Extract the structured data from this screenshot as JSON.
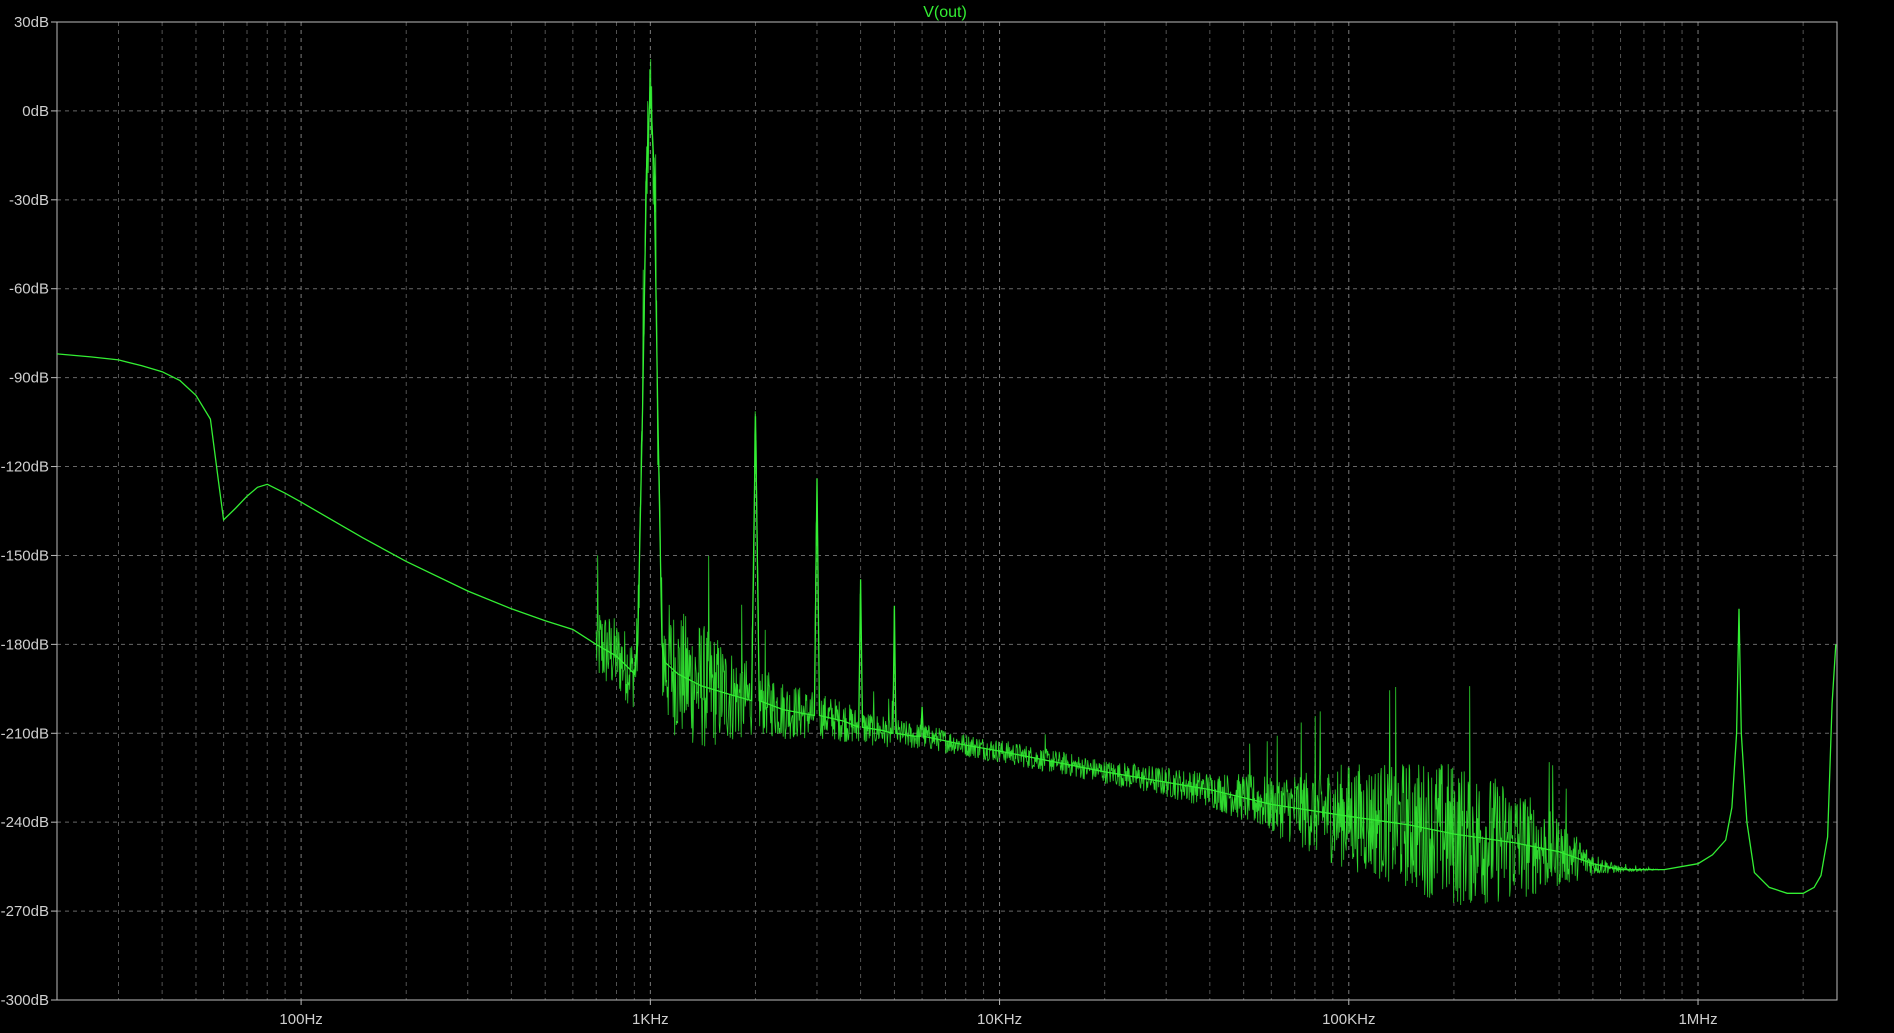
{
  "chart_data": {
    "type": "line",
    "title": "V(out)",
    "xlabel": "",
    "ylabel": "",
    "x_scale": "log",
    "x_unit": "Hz",
    "xlim": [
      20,
      2500000
    ],
    "ylim": [
      -300,
      30
    ],
    "grid": true,
    "x_ticks": [
      {
        "value": 100,
        "label": "100Hz"
      },
      {
        "value": 1000,
        "label": "1KHz"
      },
      {
        "value": 10000,
        "label": "10KHz"
      },
      {
        "value": 100000,
        "label": "100KHz"
      },
      {
        "value": 1000000,
        "label": "1MHz"
      }
    ],
    "y_ticks": [
      {
        "value": 30,
        "label": "30dB"
      },
      {
        "value": 0,
        "label": "0dB"
      },
      {
        "value": -30,
        "label": "-30dB"
      },
      {
        "value": -60,
        "label": "-60dB"
      },
      {
        "value": -90,
        "label": "-90dB"
      },
      {
        "value": -120,
        "label": "-120dB"
      },
      {
        "value": -150,
        "label": "-150dB"
      },
      {
        "value": -180,
        "label": "-180dB"
      },
      {
        "value": -210,
        "label": "-210dB"
      },
      {
        "value": -240,
        "label": "-240dB"
      },
      {
        "value": -270,
        "label": "-270dB"
      },
      {
        "value": -300,
        "label": "-300dB"
      }
    ],
    "series": [
      {
        "name": "V(out)",
        "color": "#33ee33",
        "points": [
          [
            20,
            -82
          ],
          [
            25,
            -83
          ],
          [
            30,
            -84
          ],
          [
            35,
            -86
          ],
          [
            40,
            -88
          ],
          [
            45,
            -91
          ],
          [
            50,
            -96
          ],
          [
            55,
            -104
          ],
          [
            58,
            -125
          ],
          [
            60,
            -138
          ],
          [
            65,
            -134
          ],
          [
            70,
            -130
          ],
          [
            75,
            -127
          ],
          [
            80,
            -126
          ],
          [
            90,
            -129
          ],
          [
            100,
            -132
          ],
          [
            150,
            -144
          ],
          [
            200,
            -152
          ],
          [
            300,
            -162
          ],
          [
            400,
            -168
          ],
          [
            500,
            -172
          ],
          [
            600,
            -175
          ],
          [
            700,
            -180
          ],
          [
            800,
            -184
          ],
          [
            850,
            -187
          ],
          [
            900,
            -190
          ],
          [
            920,
            -180
          ],
          [
            950,
            -100
          ],
          [
            975,
            -20
          ],
          [
            1000,
            8
          ],
          [
            1025,
            -20
          ],
          [
            1050,
            -100
          ],
          [
            1080,
            -180
          ],
          [
            1100,
            -186
          ],
          [
            1200,
            -190
          ],
          [
            1400,
            -194
          ],
          [
            1700,
            -197
          ],
          [
            1950,
            -199
          ],
          [
            2000,
            -103
          ],
          [
            2050,
            -199
          ],
          [
            2400,
            -202
          ],
          [
            2950,
            -204
          ],
          [
            3000,
            -124
          ],
          [
            3050,
            -204
          ],
          [
            3600,
            -206
          ],
          [
            3950,
            -208
          ],
          [
            4000,
            -158
          ],
          [
            4050,
            -208
          ],
          [
            4600,
            -209
          ],
          [
            4950,
            -210
          ],
          [
            5000,
            -167
          ],
          [
            5050,
            -210
          ],
          [
            5700,
            -211
          ],
          [
            5950,
            -211
          ],
          [
            6000,
            -201
          ],
          [
            6050,
            -211
          ],
          [
            8000,
            -214
          ],
          [
            10000,
            -216
          ],
          [
            20000,
            -223
          ],
          [
            40000,
            -229
          ],
          [
            60000,
            -234
          ],
          [
            100000,
            -238
          ],
          [
            150000,
            -241
          ],
          [
            200000,
            -244
          ],
          [
            300000,
            -247
          ],
          [
            400000,
            -250
          ],
          [
            500000,
            -254
          ],
          [
            600000,
            -256
          ],
          [
            700000,
            -256
          ],
          [
            800000,
            -256
          ],
          [
            1000000,
            -254
          ],
          [
            1100000,
            -251
          ],
          [
            1200000,
            -246
          ],
          [
            1250000,
            -235
          ],
          [
            1290000,
            -210
          ],
          [
            1310000,
            -168
          ],
          [
            1330000,
            -210
          ],
          [
            1380000,
            -240
          ],
          [
            1450000,
            -257
          ],
          [
            1600000,
            -262
          ],
          [
            1800000,
            -264
          ],
          [
            2000000,
            -264
          ],
          [
            2150000,
            -262
          ],
          [
            2250000,
            -258
          ],
          [
            2350000,
            -245
          ],
          [
            2420000,
            -200
          ],
          [
            2480000,
            -180
          ]
        ],
        "noise_band": [
          [
            700,
            14
          ],
          [
            900,
            12
          ],
          [
            1100,
            22
          ],
          [
            1400,
            22
          ],
          [
            2000,
            12
          ],
          [
            3000,
            8
          ],
          [
            5000,
            5
          ],
          [
            7000,
            4
          ],
          [
            10000,
            4
          ],
          [
            20000,
            4
          ],
          [
            40000,
            6
          ],
          [
            60000,
            10
          ],
          [
            90000,
            17
          ],
          [
            150000,
            22
          ],
          [
            200000,
            25
          ],
          [
            300000,
            20
          ],
          [
            400000,
            12
          ],
          [
            500000,
            4
          ],
          [
            600000,
            1
          ],
          [
            800000,
            0
          ]
        ]
      }
    ]
  }
}
